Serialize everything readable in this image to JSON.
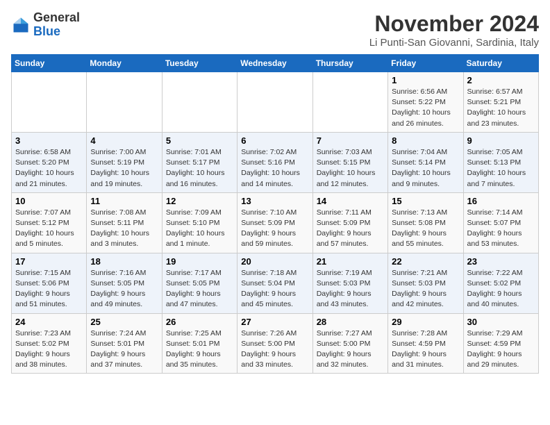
{
  "logo": {
    "general": "General",
    "blue": "Blue"
  },
  "header": {
    "month": "November 2024",
    "location": "Li Punti-San Giovanni, Sardinia, Italy"
  },
  "weekdays": [
    "Sunday",
    "Monday",
    "Tuesday",
    "Wednesday",
    "Thursday",
    "Friday",
    "Saturday"
  ],
  "weeks": [
    [
      {
        "day": "",
        "info": ""
      },
      {
        "day": "",
        "info": ""
      },
      {
        "day": "",
        "info": ""
      },
      {
        "day": "",
        "info": ""
      },
      {
        "day": "",
        "info": ""
      },
      {
        "day": "1",
        "info": "Sunrise: 6:56 AM\nSunset: 5:22 PM\nDaylight: 10 hours\nand 26 minutes."
      },
      {
        "day": "2",
        "info": "Sunrise: 6:57 AM\nSunset: 5:21 PM\nDaylight: 10 hours\nand 23 minutes."
      }
    ],
    [
      {
        "day": "3",
        "info": "Sunrise: 6:58 AM\nSunset: 5:20 PM\nDaylight: 10 hours\nand 21 minutes."
      },
      {
        "day": "4",
        "info": "Sunrise: 7:00 AM\nSunset: 5:19 PM\nDaylight: 10 hours\nand 19 minutes."
      },
      {
        "day": "5",
        "info": "Sunrise: 7:01 AM\nSunset: 5:17 PM\nDaylight: 10 hours\nand 16 minutes."
      },
      {
        "day": "6",
        "info": "Sunrise: 7:02 AM\nSunset: 5:16 PM\nDaylight: 10 hours\nand 14 minutes."
      },
      {
        "day": "7",
        "info": "Sunrise: 7:03 AM\nSunset: 5:15 PM\nDaylight: 10 hours\nand 12 minutes."
      },
      {
        "day": "8",
        "info": "Sunrise: 7:04 AM\nSunset: 5:14 PM\nDaylight: 10 hours\nand 9 minutes."
      },
      {
        "day": "9",
        "info": "Sunrise: 7:05 AM\nSunset: 5:13 PM\nDaylight: 10 hours\nand 7 minutes."
      }
    ],
    [
      {
        "day": "10",
        "info": "Sunrise: 7:07 AM\nSunset: 5:12 PM\nDaylight: 10 hours\nand 5 minutes."
      },
      {
        "day": "11",
        "info": "Sunrise: 7:08 AM\nSunset: 5:11 PM\nDaylight: 10 hours\nand 3 minutes."
      },
      {
        "day": "12",
        "info": "Sunrise: 7:09 AM\nSunset: 5:10 PM\nDaylight: 10 hours\nand 1 minute."
      },
      {
        "day": "13",
        "info": "Sunrise: 7:10 AM\nSunset: 5:09 PM\nDaylight: 9 hours\nand 59 minutes."
      },
      {
        "day": "14",
        "info": "Sunrise: 7:11 AM\nSunset: 5:09 PM\nDaylight: 9 hours\nand 57 minutes."
      },
      {
        "day": "15",
        "info": "Sunrise: 7:13 AM\nSunset: 5:08 PM\nDaylight: 9 hours\nand 55 minutes."
      },
      {
        "day": "16",
        "info": "Sunrise: 7:14 AM\nSunset: 5:07 PM\nDaylight: 9 hours\nand 53 minutes."
      }
    ],
    [
      {
        "day": "17",
        "info": "Sunrise: 7:15 AM\nSunset: 5:06 PM\nDaylight: 9 hours\nand 51 minutes."
      },
      {
        "day": "18",
        "info": "Sunrise: 7:16 AM\nSunset: 5:05 PM\nDaylight: 9 hours\nand 49 minutes."
      },
      {
        "day": "19",
        "info": "Sunrise: 7:17 AM\nSunset: 5:05 PM\nDaylight: 9 hours\nand 47 minutes."
      },
      {
        "day": "20",
        "info": "Sunrise: 7:18 AM\nSunset: 5:04 PM\nDaylight: 9 hours\nand 45 minutes."
      },
      {
        "day": "21",
        "info": "Sunrise: 7:19 AM\nSunset: 5:03 PM\nDaylight: 9 hours\nand 43 minutes."
      },
      {
        "day": "22",
        "info": "Sunrise: 7:21 AM\nSunset: 5:03 PM\nDaylight: 9 hours\nand 42 minutes."
      },
      {
        "day": "23",
        "info": "Sunrise: 7:22 AM\nSunset: 5:02 PM\nDaylight: 9 hours\nand 40 minutes."
      }
    ],
    [
      {
        "day": "24",
        "info": "Sunrise: 7:23 AM\nSunset: 5:02 PM\nDaylight: 9 hours\nand 38 minutes."
      },
      {
        "day": "25",
        "info": "Sunrise: 7:24 AM\nSunset: 5:01 PM\nDaylight: 9 hours\nand 37 minutes."
      },
      {
        "day": "26",
        "info": "Sunrise: 7:25 AM\nSunset: 5:01 PM\nDaylight: 9 hours\nand 35 minutes."
      },
      {
        "day": "27",
        "info": "Sunrise: 7:26 AM\nSunset: 5:00 PM\nDaylight: 9 hours\nand 33 minutes."
      },
      {
        "day": "28",
        "info": "Sunrise: 7:27 AM\nSunset: 5:00 PM\nDaylight: 9 hours\nand 32 minutes."
      },
      {
        "day": "29",
        "info": "Sunrise: 7:28 AM\nSunset: 4:59 PM\nDaylight: 9 hours\nand 31 minutes."
      },
      {
        "day": "30",
        "info": "Sunrise: 7:29 AM\nSunset: 4:59 PM\nDaylight: 9 hours\nand 29 minutes."
      }
    ]
  ]
}
